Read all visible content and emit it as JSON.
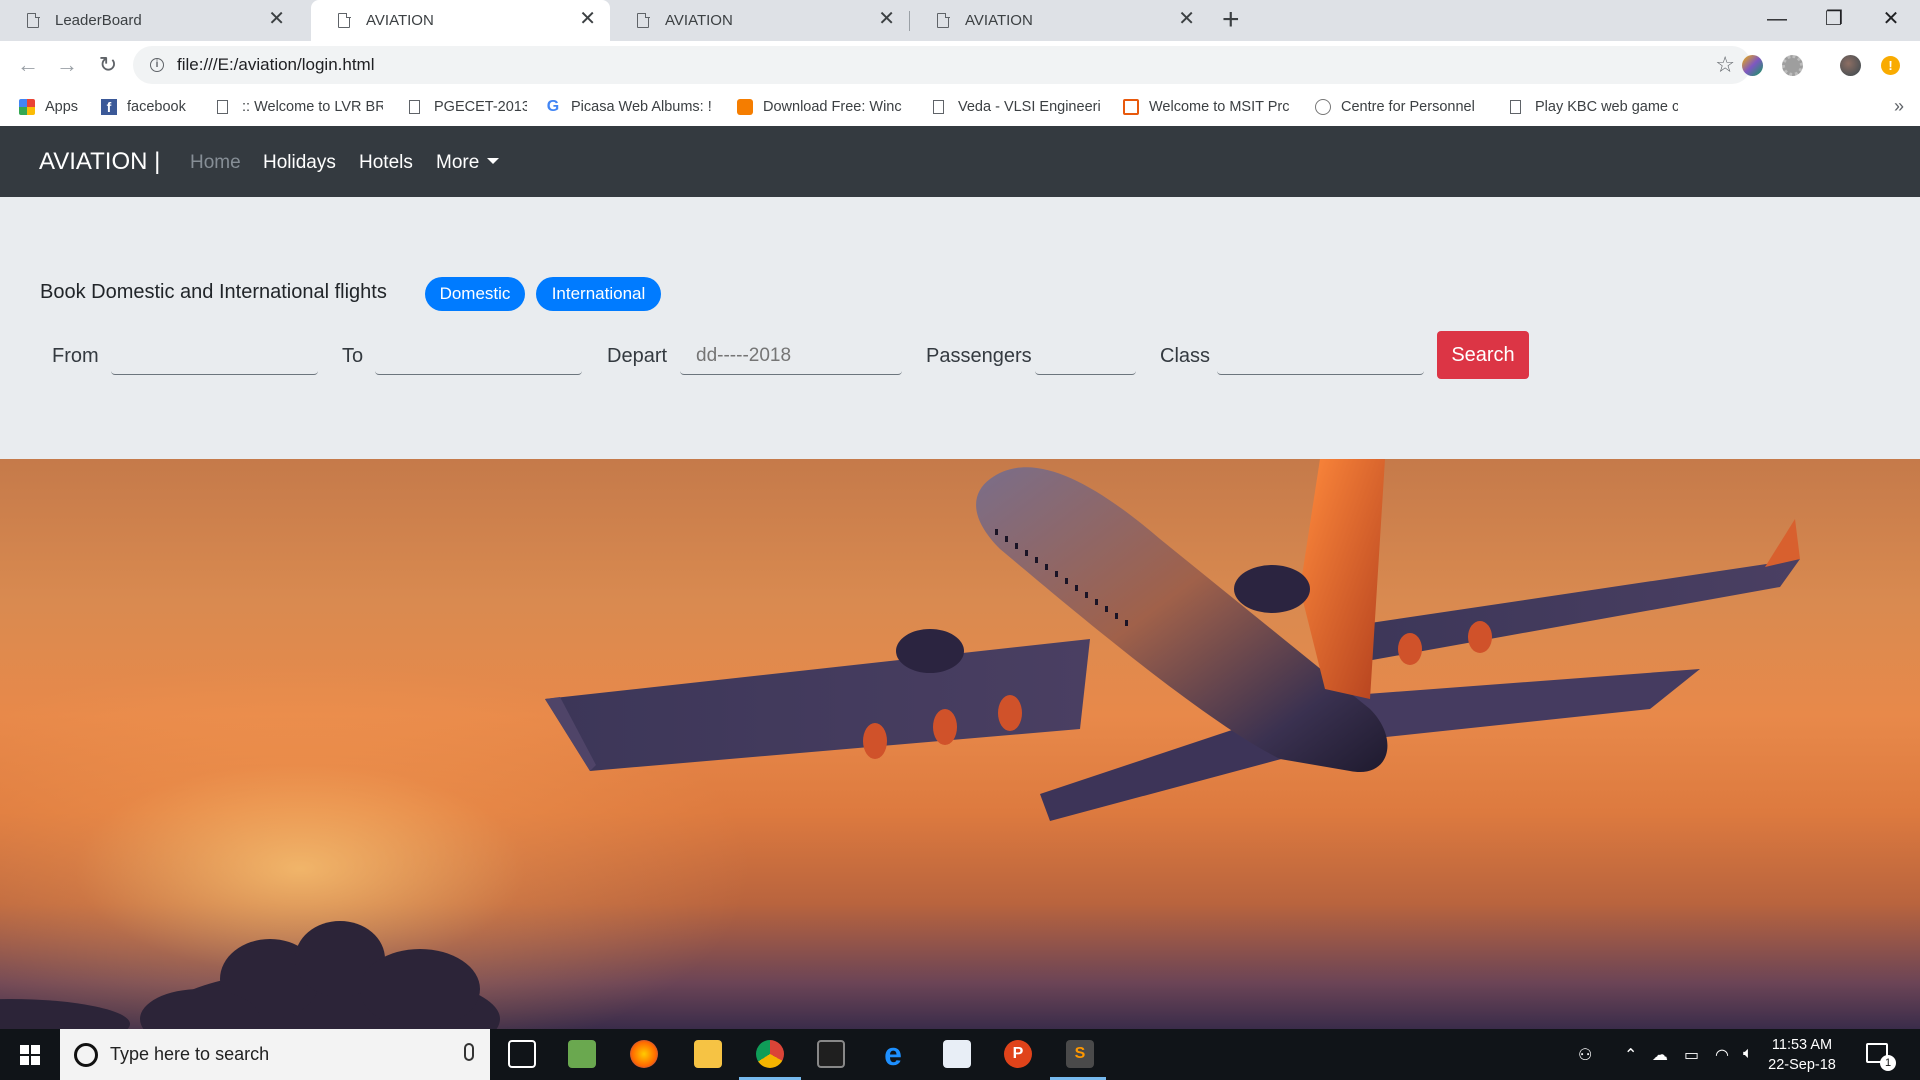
{
  "browser": {
    "tabs": [
      {
        "title": "LeaderBoard",
        "active": false
      },
      {
        "title": "AVIATION",
        "active": true
      },
      {
        "title": "AVIATION",
        "active": false
      },
      {
        "title": "AVIATION",
        "active": false
      }
    ],
    "tab_close_glyph": "✕",
    "new_tab_glyph": "+",
    "window_controls": {
      "minimize": "—",
      "maximize": "❐",
      "close": "✕"
    },
    "url": "file:///E:/aviation/login.html",
    "bookmarks": [
      {
        "label": "Apps",
        "icon": "apps-grid-icon"
      },
      {
        "label": "facebook",
        "icon": "facebook-icon"
      },
      {
        "label": ":: Welcome to LVR BR",
        "icon": "document-icon"
      },
      {
        "label": "PGECET-2013",
        "icon": "document-icon"
      },
      {
        "label": "Picasa Web Albums: !",
        "icon": "google-icon"
      },
      {
        "label": "Download Free: Winc",
        "icon": "blogger-icon"
      },
      {
        "label": "Veda - VLSI Engineeri",
        "icon": "document-icon"
      },
      {
        "label": "Welcome to MSIT Prc",
        "icon": "msit-icon"
      },
      {
        "label": "Centre for Personnel",
        "icon": "emblem-icon"
      },
      {
        "label": "Play KBC web game c",
        "icon": "document-icon"
      }
    ],
    "bookmarks_overflow": "»"
  },
  "navbar": {
    "brand": "AVIATION |",
    "links": [
      "Home",
      "Holidays",
      "Hotels",
      "More"
    ]
  },
  "booking": {
    "headline": "Book Domestic and International flights",
    "pills": [
      "Domestic",
      "International"
    ],
    "fields": {
      "from_label": "From",
      "to_label": "To",
      "depart_label": "Depart",
      "depart_placeholder": "dd-----2018",
      "passengers_label": "Passengers",
      "class_label": "Class"
    },
    "search_button": "Search"
  },
  "taskbar": {
    "search_placeholder": "Type here to search",
    "time": "11:53 AM",
    "date": "22-Sep-18",
    "notification_count": "1"
  },
  "colors": {
    "navbar_bg": "#343a40",
    "panel_bg": "#e9ecef",
    "pill_blue": "#007bff",
    "search_red": "#dc3545",
    "tabstrip_bg": "#dee1e6",
    "taskbar_bg": "#101418"
  }
}
